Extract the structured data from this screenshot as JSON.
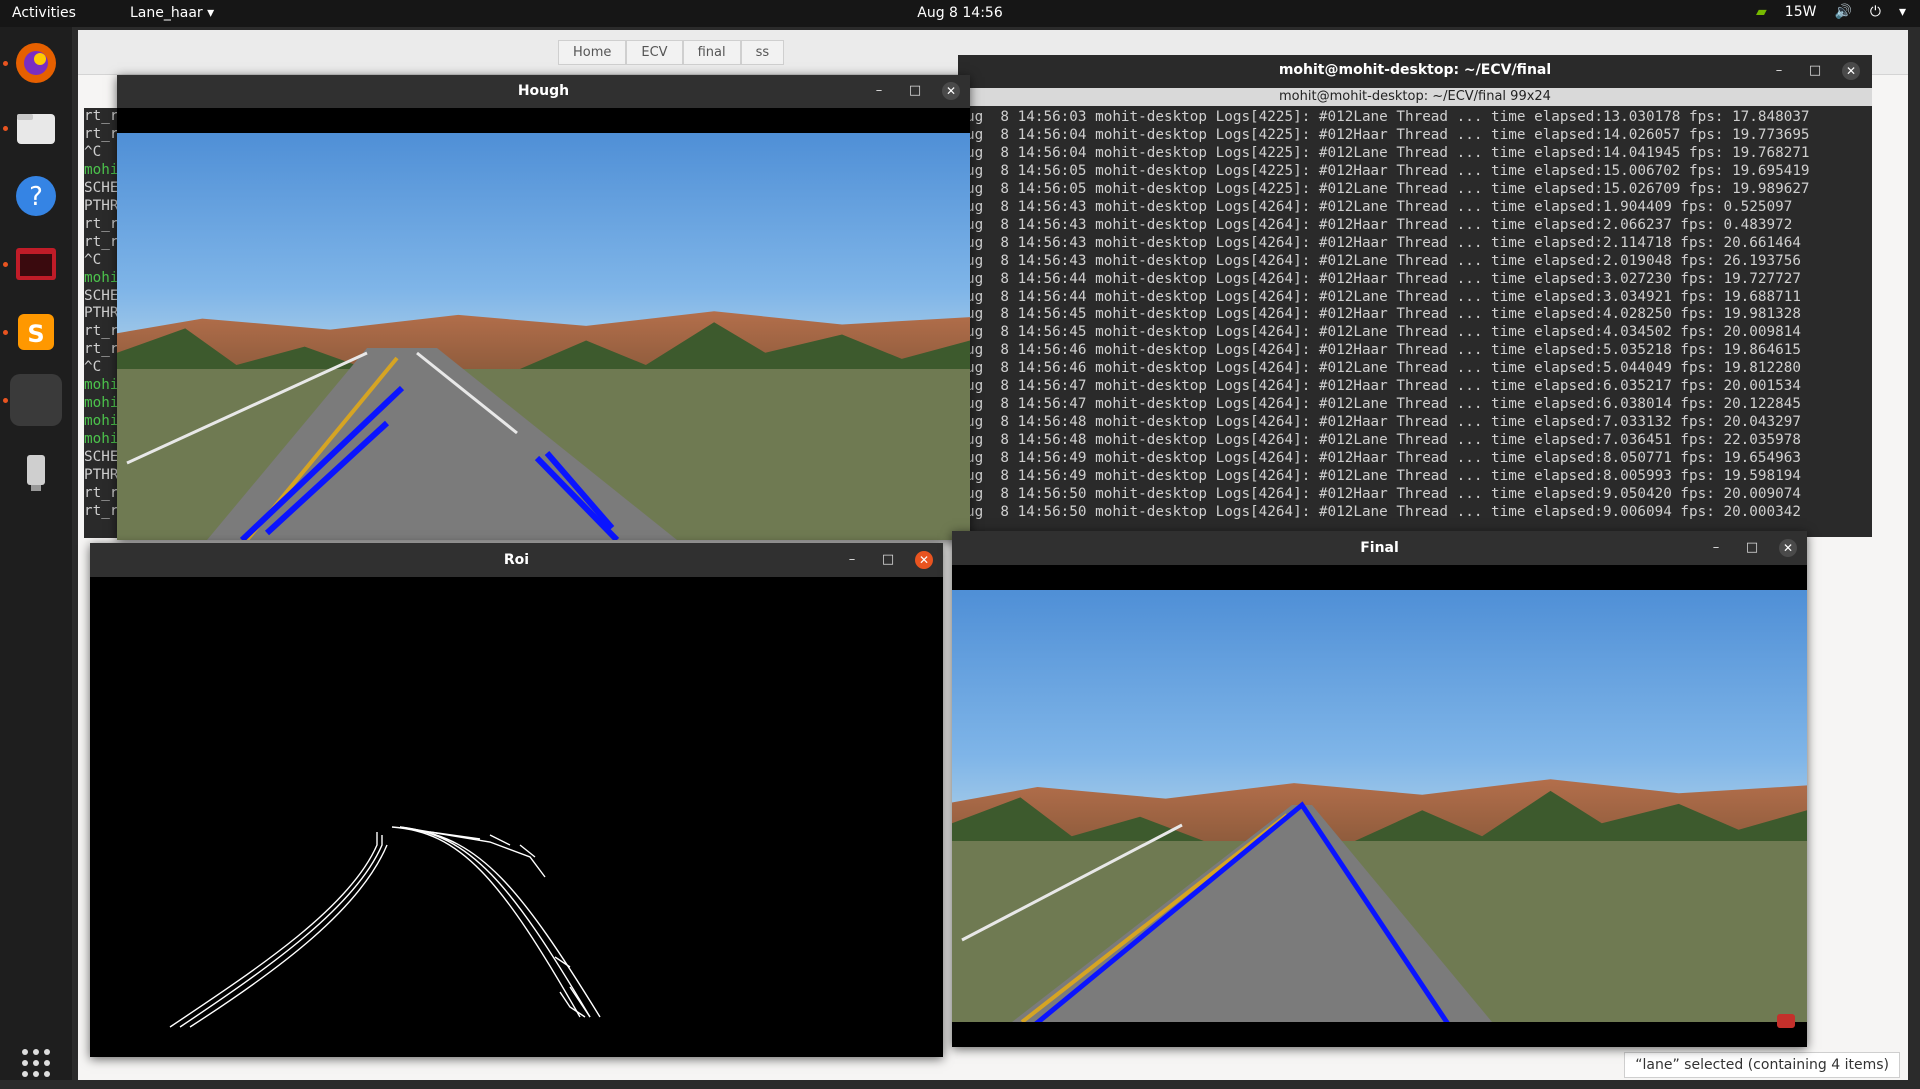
{
  "topbar": {
    "activities": "Activities",
    "app_menu": "Lane_haar ▾",
    "clock": "Aug 8  14:56",
    "power": "15W"
  },
  "files": {
    "breadcrumbs": [
      "Home",
      "ECV",
      "final",
      "ss"
    ],
    "status": "“lane” selected  (containing 4 items)"
  },
  "terminal": {
    "window_title": "mohit@mohit-desktop: ~/ECV/final",
    "tab_title": "mohit@mohit-desktop: ~/ECV/final 99x24",
    "lines": [
      "ug  8 14:56:03 mohit-desktop Logs[4225]: #012Lane Thread ... time elapsed:13.030178 fps: 17.848037",
      "ug  8 14:56:04 mohit-desktop Logs[4225]: #012Haar Thread ... time elapsed:14.026057 fps: 19.773695",
      "ug  8 14:56:04 mohit-desktop Logs[4225]: #012Lane Thread ... time elapsed:14.041945 fps: 19.768271",
      "ug  8 14:56:05 mohit-desktop Logs[4225]: #012Haar Thread ... time elapsed:15.006702 fps: 19.695419",
      "ug  8 14:56:05 mohit-desktop Logs[4225]: #012Lane Thread ... time elapsed:15.026709 fps: 19.989627",
      "ug  8 14:56:43 mohit-desktop Logs[4264]: #012Lane Thread ... time elapsed:1.904409 fps: 0.525097",
      "ug  8 14:56:43 mohit-desktop Logs[4264]: #012Haar Thread ... time elapsed:2.066237 fps: 0.483972",
      "ug  8 14:56:43 mohit-desktop Logs[4264]: #012Haar Thread ... time elapsed:2.114718 fps: 20.661464",
      "ug  8 14:56:43 mohit-desktop Logs[4264]: #012Lane Thread ... time elapsed:2.019048 fps: 26.193756",
      "ug  8 14:56:44 mohit-desktop Logs[4264]: #012Haar Thread ... time elapsed:3.027230 fps: 19.727727",
      "ug  8 14:56:44 mohit-desktop Logs[4264]: #012Lane Thread ... time elapsed:3.034921 fps: 19.688711",
      "ug  8 14:56:45 mohit-desktop Logs[4264]: #012Haar Thread ... time elapsed:4.028250 fps: 19.981328",
      "ug  8 14:56:45 mohit-desktop Logs[4264]: #012Lane Thread ... time elapsed:4.034502 fps: 20.009814",
      "ug  8 14:56:46 mohit-desktop Logs[4264]: #012Haar Thread ... time elapsed:5.035218 fps: 19.864615",
      "ug  8 14:56:46 mohit-desktop Logs[4264]: #012Lane Thread ... time elapsed:5.044049 fps: 19.812280",
      "ug  8 14:56:47 mohit-desktop Logs[4264]: #012Haar Thread ... time elapsed:6.035217 fps: 20.001534",
      "ug  8 14:56:47 mohit-desktop Logs[4264]: #012Lane Thread ... time elapsed:6.038014 fps: 20.122845",
      "ug  8 14:56:48 mohit-desktop Logs[4264]: #012Haar Thread ... time elapsed:7.033132 fps: 20.043297",
      "ug  8 14:56:48 mohit-desktop Logs[4264]: #012Lane Thread ... time elapsed:7.036451 fps: 22.035978",
      "ug  8 14:56:49 mohit-desktop Logs[4264]: #012Haar Thread ... time elapsed:8.050771 fps: 19.654963",
      "ug  8 14:56:49 mohit-desktop Logs[4264]: #012Lane Thread ... time elapsed:8.005993 fps: 19.598194",
      "ug  8 14:56:50 mohit-desktop Logs[4264]: #012Haar Thread ... time elapsed:9.050420 fps: 20.009074",
      "ug  8 14:56:50 mohit-desktop Logs[4264]: #012Lane Thread ... time elapsed:9.006094 fps: 20.000342"
    ],
    "left_fragments": [
      "rt_r",
      "rt_r",
      "^C",
      "mohi",
      "SCHE",
      "PTHR",
      "rt_r",
      "rt_r",
      "^C",
      "mohi",
      "SCHE",
      "PTHR",
      "rt_r",
      "rt_r",
      "^C",
      "mohi",
      "mohi",
      "mohi",
      "mohi",
      "SCHE",
      "PTHR",
      "rt_r",
      "rt_r"
    ]
  },
  "windows": {
    "hough_title": "Hough",
    "roi_title": "Roi",
    "final_title": "Final"
  },
  "colors": {
    "lane_blue": "#0a14ff",
    "accent": "#e95420"
  }
}
